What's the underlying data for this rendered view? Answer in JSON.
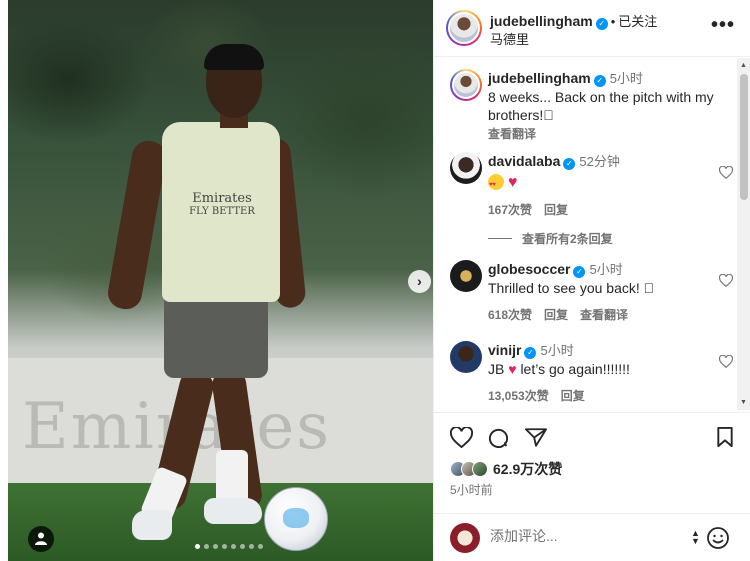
{
  "media": {
    "banner_text": "Emirates",
    "shirt_sponsor_line1": "Emirates",
    "shirt_sponsor_line2": "FLY BETTER",
    "carousel": {
      "total": 8,
      "active": 1
    }
  },
  "header": {
    "username": "judebellingham",
    "follow_label": "已关注",
    "location": "马德里",
    "more_label": "•••"
  },
  "caption": {
    "username": "judebellingham",
    "time": "5小时",
    "text": "8 weeks... Back on the pitch with my brothers!􀀀",
    "translate": "查看翻译"
  },
  "comments": [
    {
      "username": "davidalaba",
      "time": "52分钟",
      "text": "",
      "likes": "167次赞",
      "reply": "回复",
      "translate": ""
    },
    {
      "username": "globesoccer",
      "time": "5小时",
      "text": "Thrilled to see you back! 􀀀",
      "likes": "618次赞",
      "reply": "回复",
      "translate": "查看翻译"
    },
    {
      "username": "vinijr",
      "time": "5小时",
      "text": "let’s go again!!!!!!!",
      "prefix": "JB",
      "likes": "13,053次赞",
      "reply": "回复",
      "translate": ""
    }
  ],
  "view_replies": "查看所有2条回复",
  "likes": {
    "count_text": "62.9万次赞"
  },
  "posted": "5小时前",
  "comment_box": {
    "placeholder": "添加评论..."
  },
  "icons": [
    "heart-icon",
    "comment-icon",
    "share-icon",
    "bookmark-icon",
    "emoji-icon",
    "person-tag-icon",
    "chevron-right-icon"
  ],
  "colors": {
    "accent": "#0095f6",
    "like_red": "#e0245e",
    "muted": "#737373"
  }
}
